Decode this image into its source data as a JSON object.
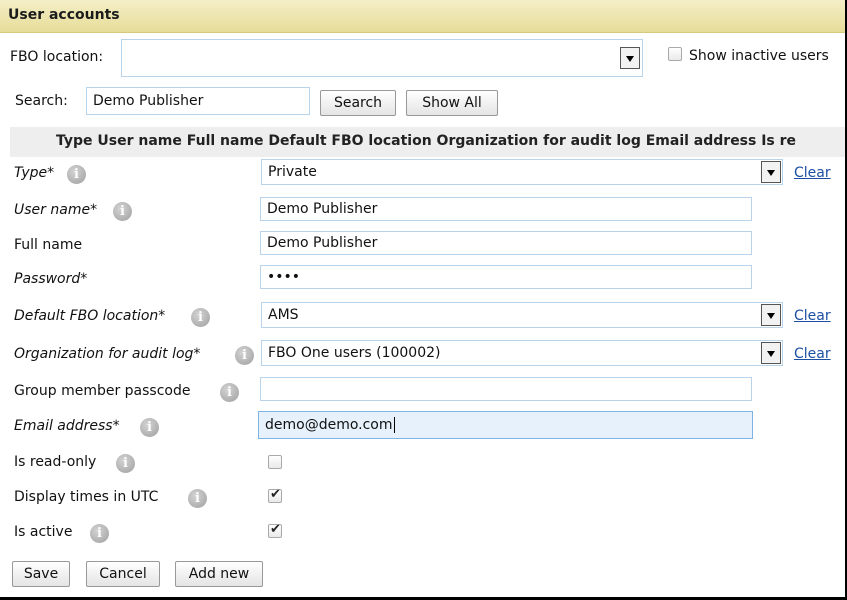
{
  "header": {
    "title": "User accounts"
  },
  "filters": {
    "fbo_label": "FBO location:",
    "fbo_value": "",
    "show_inactive_label": "Show inactive users",
    "search_label": "Search:",
    "search_value": "Demo Publisher",
    "search_button": "Search",
    "show_all_button": "Show All"
  },
  "table_header": {
    "columns": "Type  User name  Full name  Default FBO location  Organization for audit log  Email address  Is re"
  },
  "form": {
    "type": {
      "label": "Type*",
      "value": "Private",
      "clear": "Clear"
    },
    "user_name": {
      "label": "User name*",
      "value": "Demo Publisher"
    },
    "full_name": {
      "label": "Full name",
      "value": "Demo Publisher"
    },
    "password": {
      "label": "Password*",
      "value": "••••"
    },
    "default_fbo": {
      "label": "Default FBO location*",
      "value": "AMS",
      "clear": "Clear"
    },
    "org_audit": {
      "label": "Organization for audit log*",
      "value": "FBO One users (100002)",
      "clear": "Clear"
    },
    "group_passcode": {
      "label": "Group member passcode",
      "value": ""
    },
    "email": {
      "label": "Email address*",
      "value": "demo@demo.com"
    },
    "is_read_only": {
      "label": "Is read-only",
      "checked": false
    },
    "display_utc": {
      "label": "Display times in UTC",
      "checked": true
    },
    "is_active": {
      "label": "Is active",
      "checked": true
    }
  },
  "actions": {
    "save": "Save",
    "cancel": "Cancel",
    "add_new": "Add new"
  },
  "icons": {
    "info": "i",
    "check": "✔"
  },
  "colors": {
    "header_bg": "#ebe3a8",
    "link": "#1c4fa3",
    "focus_bg": "#e6f1fb"
  }
}
